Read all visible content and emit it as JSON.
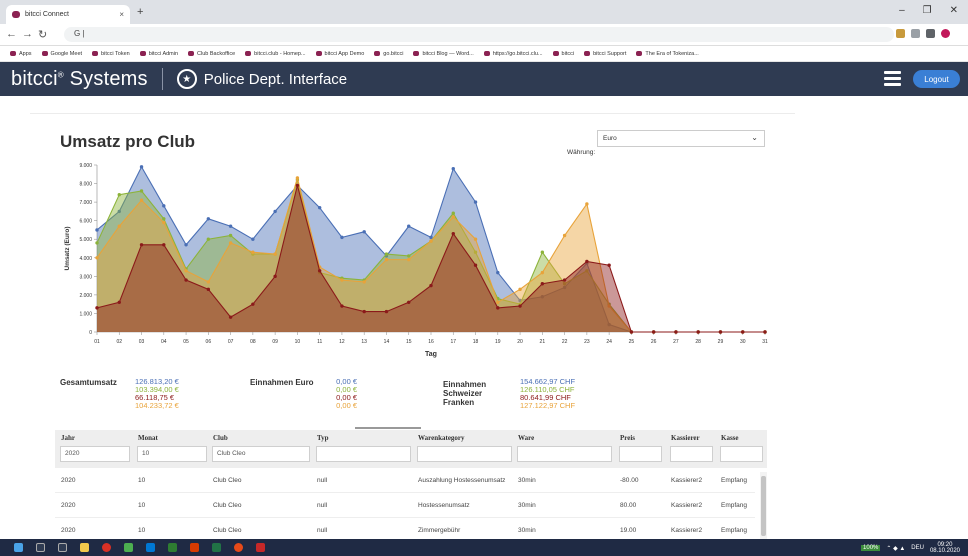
{
  "browser": {
    "tab_title": "bitcci Connect",
    "tab_close": "×",
    "new_tab": "+",
    "url": "G |",
    "bookmarks": [
      "Apps",
      "Google Meet",
      "bitcci Token",
      "bitcci Admin",
      "Club Backoffice",
      "bitcci.club - Homep...",
      "bitcci App Demo",
      "go.bitcci",
      "bitcci Blog — Word...",
      "https://go.bitcci.clu...",
      "bitcci",
      "bitcci Support",
      "The Era of Tokeniza..."
    ]
  },
  "header": {
    "brand": "bitcci",
    "brand_mark": "®",
    "brand_rest": " Systems",
    "subtitle": "Police Dept. Interface",
    "logout": "Logout"
  },
  "page": {
    "title": "Umsatz pro Club",
    "waehrung_label": "Währung:",
    "waehrung_value": "Euro"
  },
  "colors": {
    "blue": "#4a6fb5",
    "green": "#8cb33a",
    "orange": "#e8a33a",
    "red": "#8b1a1a",
    "nav": "#2f3b52",
    "logout": "#3a7fd5"
  },
  "chart_data": {
    "type": "area",
    "xlabel": "Tag",
    "ylabel": "Umsatz (Euro)",
    "ylim": [
      0,
      9000
    ],
    "yticks": [
      "0",
      "1.000",
      "2.000",
      "3.000",
      "4.000",
      "5.000",
      "6.000",
      "7.000",
      "8.000",
      "9.000"
    ],
    "categories": [
      "01",
      "02",
      "03",
      "04",
      "05",
      "06",
      "07",
      "08",
      "09",
      "10",
      "11",
      "12",
      "13",
      "14",
      "15",
      "16",
      "17",
      "18",
      "19",
      "20",
      "21",
      "22",
      "23",
      "24",
      "25",
      "26",
      "27",
      "28",
      "29",
      "30",
      "31"
    ],
    "series": [
      {
        "color": "#4a6fb5",
        "values": [
          5500,
          6500,
          8900,
          6800,
          4700,
          6100,
          5700,
          5000,
          6500,
          7900,
          6700,
          5100,
          5400,
          4100,
          5700,
          5100,
          8800,
          7000,
          3200,
          1700,
          1900,
          2400,
          3700,
          400,
          0,
          0,
          0,
          0,
          0,
          0,
          0
        ]
      },
      {
        "color": "#8cb33a",
        "values": [
          4800,
          7400,
          7600,
          6100,
          3400,
          5000,
          5200,
          4200,
          4200,
          8200,
          3200,
          2900,
          2800,
          4200,
          4100,
          4900,
          6400,
          4300,
          1800,
          1500,
          4300,
          2600,
          3300,
          1500,
          0,
          0,
          0,
          0,
          0,
          0,
          0
        ]
      },
      {
        "color": "#e8a33a",
        "values": [
          4000,
          5700,
          7100,
          5900,
          3300,
          2700,
          4800,
          4300,
          4200,
          8300,
          3500,
          2800,
          2700,
          3900,
          3900,
          4900,
          6200,
          5000,
          1600,
          2300,
          3200,
          5200,
          6900,
          1400,
          0,
          0,
          0,
          0,
          0,
          0,
          0
        ]
      },
      {
        "color": "#8b1a1a",
        "values": [
          1300,
          1600,
          4700,
          4700,
          2800,
          2300,
          800,
          1500,
          3000,
          7900,
          3300,
          1400,
          1100,
          1100,
          1600,
          2500,
          5300,
          3600,
          1300,
          1400,
          2600,
          2800,
          3800,
          3600,
          0,
          0,
          0,
          0,
          0,
          0,
          0
        ]
      }
    ]
  },
  "summary": {
    "gesamt_label": "Gesamtumsatz",
    "gesamt_values": [
      "126.813,20 €",
      "103.394,00 €",
      "66.118,75 €",
      "104.233,72 €"
    ],
    "euro_label": "Einnahmen Euro",
    "euro_values": [
      "0,00 €",
      "0,00 €",
      "0,00 €",
      "0,00 €"
    ],
    "chf_label": [
      "Einnahmen",
      "Schweizer",
      "Franken"
    ],
    "chf_values": [
      "154.662,97 CHF",
      "126.110,05 CHF",
      "80.641,99 CHF",
      "127.122,97 CHF"
    ]
  },
  "table": {
    "headers": [
      "Jahr",
      "Monat",
      "Club",
      "Typ",
      "Warenkategory",
      "Ware",
      "Preis",
      "Kassierer",
      "Kasse"
    ],
    "filters": [
      "2020",
      "10",
      "Club Cleo",
      "",
      "",
      "",
      "",
      "",
      ""
    ],
    "rows": [
      [
        "2020",
        "10",
        "Club Cleo",
        "null",
        "Auszahlung Hostessenumsatz",
        "30min",
        "-80.00",
        "Kassierer2",
        "Empfang"
      ],
      [
        "2020",
        "10",
        "Club Cleo",
        "null",
        "Hostessenumsatz",
        "30min",
        "80.00",
        "Kassierer2",
        "Empfang"
      ],
      [
        "2020",
        "10",
        "Club Cleo",
        "null",
        "Zimmergebühr",
        "30min",
        "19.00",
        "Kassierer2",
        "Empfang"
      ]
    ]
  },
  "taskbar": {
    "zoom": "100%",
    "lang": "DEU",
    "time": "09:20",
    "date": "08.10.2020"
  }
}
